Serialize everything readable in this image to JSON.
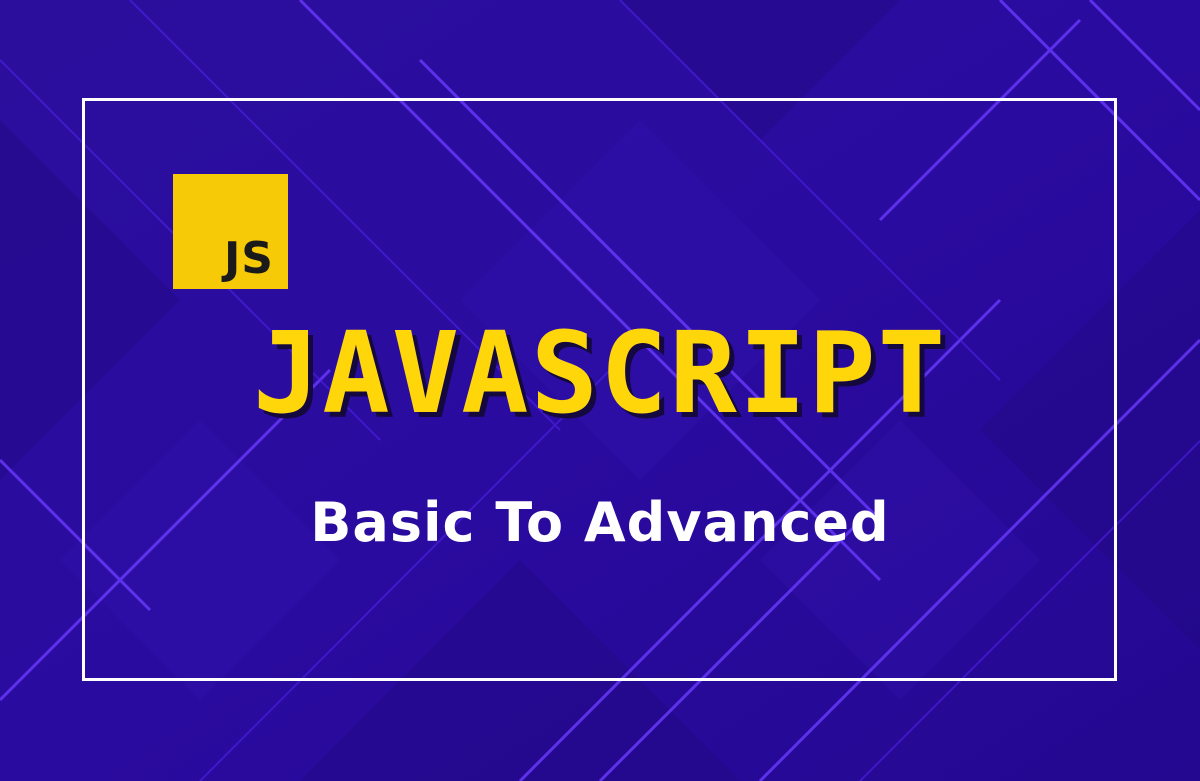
{
  "background": {
    "base_color": "#2a0c9e",
    "line_color": "#5d2cff",
    "glow_color": "#7a4dff"
  },
  "badge": {
    "text": "JS",
    "color": "#f7ca08"
  },
  "title": {
    "text": "JAVASCRIPT",
    "color": "#ffd60a"
  },
  "subtitle": {
    "text": "Basic To Advanced",
    "color": "#ffffff"
  },
  "frame": {
    "color": "#ffffff"
  }
}
